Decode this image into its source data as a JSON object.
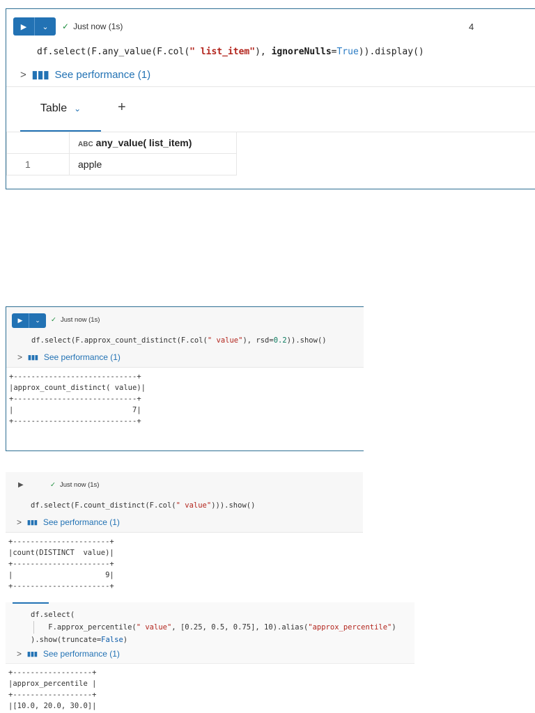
{
  "colors": {
    "accent": "#2272b4",
    "success": "#1e8e3e",
    "string": "#b3261e"
  },
  "icons": {
    "run": "play-icon",
    "menu": "chevron-down-icon",
    "done": "check-icon",
    "perf": "bar-chart-icon",
    "expand": "chevron-right-icon"
  },
  "cell1": {
    "status": "Just now (1s)",
    "cell_number": "4",
    "code": {
      "a": "df.select(F.any_value(F.col(",
      "b": "\" list_item\"",
      "c": "), ",
      "d": "ignoreNulls",
      "e": "=",
      "f": "True",
      "g": ")).display()"
    },
    "perf": "See performance (1)",
    "tab_label": "Table",
    "add_tab": "+",
    "column_header": "any_value( list_item)",
    "type_icon": "ABC",
    "rows": [
      {
        "index": "1",
        "value": "apple"
      }
    ]
  },
  "cell2": {
    "status": "Just now (1s)",
    "code": {
      "a": "df.select(F.approx_count_distinct(F.col(",
      "b": "\" value\"",
      "c": "), rsd=",
      "d": "0.2",
      "e": ")).show()"
    },
    "perf": "See performance (1)",
    "output": [
      "+----------------------------+",
      "|approx_count_distinct( value)|",
      "+----------------------------+",
      "|                           7|",
      "+----------------------------+"
    ]
  },
  "cell3": {
    "status": "Just now (1s)",
    "code": {
      "a": "df.select(F.count_distinct(F.col(",
      "b": "\" value\"",
      "c": "))).show()"
    },
    "perf": "See performance (1)",
    "output": [
      "+----------------------+",
      "|count(DISTINCT  value)|",
      "+----------------------+",
      "|                     9|",
      "+----------------------+"
    ]
  },
  "cell4": {
    "code": {
      "line1": "df.select(",
      "l2a": "    F.approx_percentile(",
      "l2b": "\" value\"",
      "l2c": ", [0.25, 0.5, 0.75], 10).alias(",
      "l2d": "\"approx_percentile\"",
      "l2e": ")",
      "l3a": ").show(truncate=",
      "l3b": "False",
      "l3c": ")"
    },
    "perf": "See performance (1)",
    "output": [
      "+------------------+",
      "|approx_percentile |",
      "+------------------+",
      "|[10.0, 20.0, 30.0]|"
    ]
  }
}
